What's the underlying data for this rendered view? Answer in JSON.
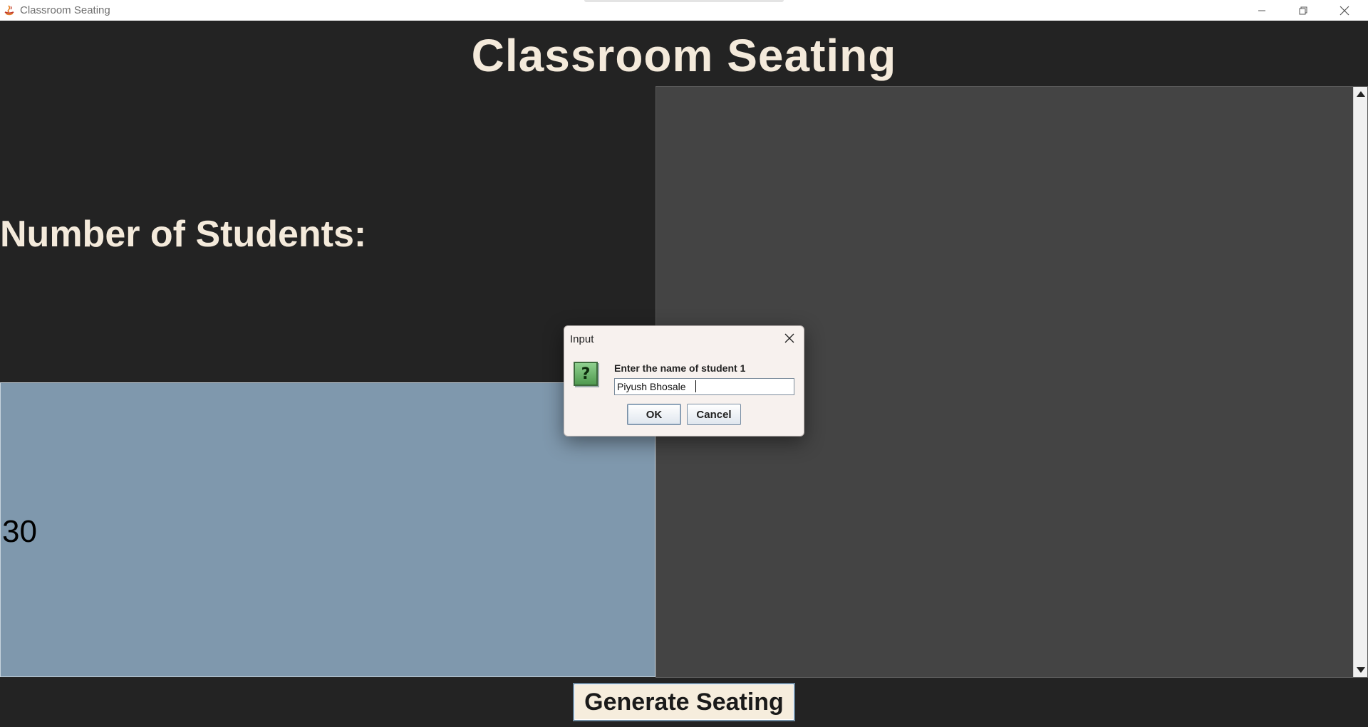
{
  "window": {
    "title": "Classroom Seating"
  },
  "main": {
    "heading": "Classroom Seating",
    "number_label": "Number of Students:",
    "student_count": "30",
    "generate_button": "Generate Seating"
  },
  "dialog": {
    "title": "Input",
    "prompt": "Enter the name of student 1",
    "input_value": "Piyush Bhosale",
    "ok_label": "OK",
    "cancel_label": "Cancel",
    "icon": "question-icon"
  },
  "colors": {
    "background": "#232323",
    "heading_text": "#f4eadb",
    "count_box": "#7f98ad",
    "seat_area": "#444444",
    "button_bg": "#f6eddd"
  }
}
